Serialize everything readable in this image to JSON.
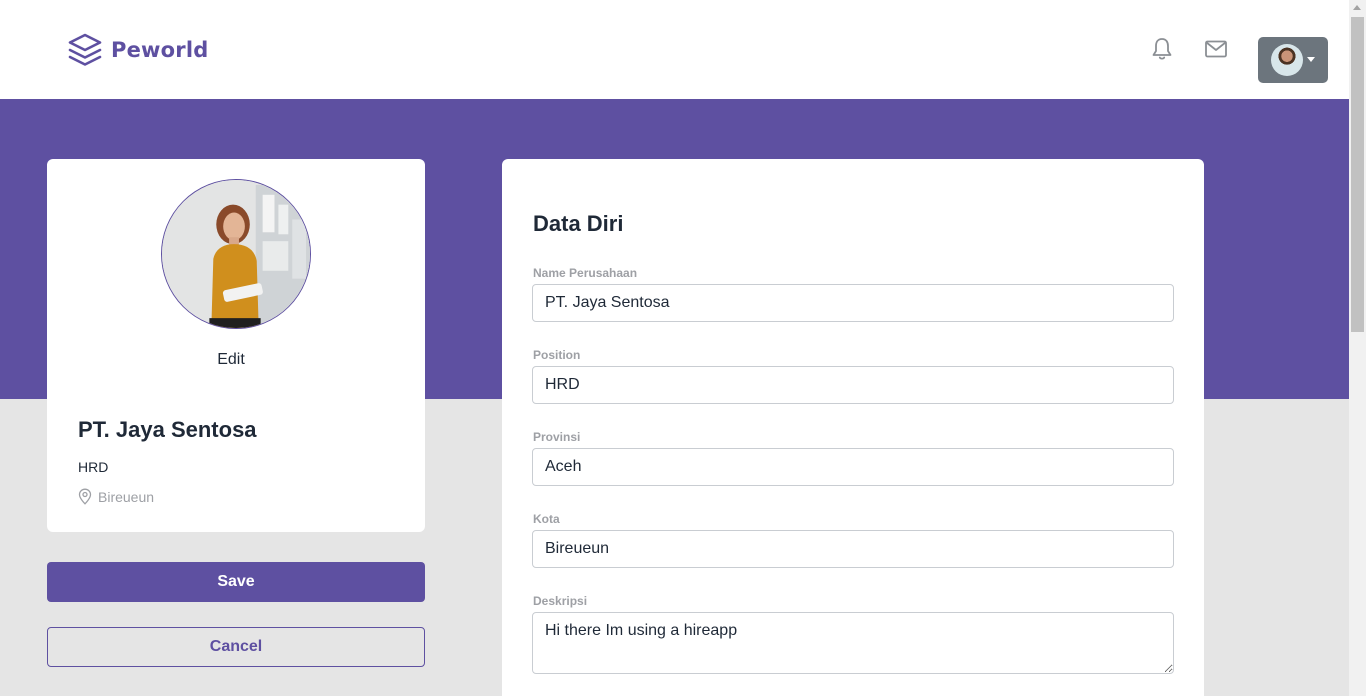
{
  "brand": {
    "name": "Peworld",
    "color": "#5e50a1"
  },
  "navbar": {
    "icons": [
      "bell-icon",
      "mail-icon"
    ],
    "profile_menu": "user-avatar-dropdown"
  },
  "profile_card": {
    "edit_label": "Edit",
    "company_name": "PT. Jaya Sentosa",
    "position": "HRD",
    "location": "Bireueun"
  },
  "actions": {
    "save_label": "Save",
    "cancel_label": "Cancel"
  },
  "form": {
    "title": "Data Diri",
    "fields": [
      {
        "label": "Name Perusahaan",
        "value": "PT. Jaya Sentosa"
      },
      {
        "label": "Position",
        "value": "HRD"
      },
      {
        "label": "Provinsi",
        "value": "Aceh"
      },
      {
        "label": "Kota",
        "value": "Bireueun"
      },
      {
        "label": "Deskripsi",
        "value": "Hi there Im using a hireapp"
      }
    ]
  }
}
